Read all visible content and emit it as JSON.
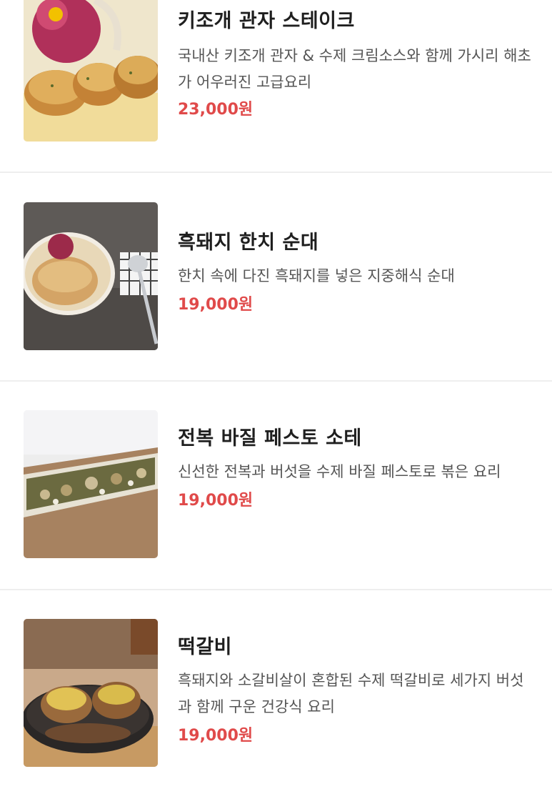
{
  "menu": {
    "items": [
      {
        "name": "키조개 관자 스테이크",
        "description": "국내산 키조개 관자 & 수제 크림소스와 함께 가시리 해초가 어우러진 고급요리",
        "price": "23,000원",
        "image": "scallop-steak-photo"
      },
      {
        "name": "흑돼지 한치 순대",
        "description": "한치 속에 다진 흑돼지를 넣은 지중해식 순대",
        "price": "19,000원",
        "image": "squid-sundae-photo"
      },
      {
        "name": "전복 바질 페스토 소테",
        "description": "신선한 전복과 버섯을 수제 바질 페스토로 볶은 요리",
        "price": "19,000원",
        "image": "abalone-pesto-photo"
      },
      {
        "name": "떡갈비",
        "description": "흑돼지와 소갈비살이 혼합된 수제 떡갈비로 세가지 버섯과 함께 구운 건강식 요리",
        "price": "19,000원",
        "image": "tteokgalbi-photo"
      }
    ]
  },
  "colors": {
    "price": "#e04a4a",
    "divider": "#eeeeee"
  }
}
